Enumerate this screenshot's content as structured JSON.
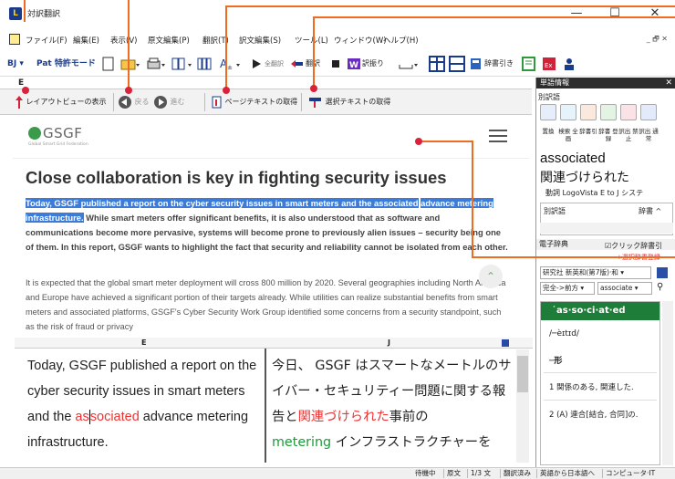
{
  "window": {
    "title": "対訳翻訳",
    "min": "—",
    "max": "☐",
    "close": "✕"
  },
  "menu": {
    "items": [
      "ファイル(F)",
      "編集(E)",
      "表示(V)",
      "原文編集(P)",
      "翻訳(T)",
      "訳文編集(S)",
      "ツール(L)",
      "ウィンドウ(W)",
      "ヘルプ(H)"
    ],
    "mdi": "_ 🗗 ✕"
  },
  "toolbar": {
    "bj": "BJ ▾",
    "pat": "Pat 特許モード",
    "all_translate": "全翻訳",
    "translate": "翻訳",
    "translate_cut": "訳振り",
    "dict_lookup": "辞書引き"
  },
  "pane_e": {
    "label": "E"
  },
  "nav": {
    "layout_view": "レイアウトビューの表示",
    "back": "戻る",
    "forward": "進む",
    "get_page_text": "ページテキストの取得",
    "get_selected_text": "選択テキストの取得"
  },
  "web": {
    "logo": "GSGF",
    "logo_tag": "Global Smart Grid Federation",
    "headline": "Close collaboration is key in fighting security issues",
    "para1_highlight_a": "Today, GSGF published a report on the cyber security issues in smart meters and the associated",
    "para1_highlight_b": "advance metering infrastructure.",
    "para1_rest": " While smart meters offer significant benefits, it is also understood that as software and communications become more pervasive, systems will become prone to previously alien issues – security being one of them. In this report, GSGF wants to highlight the fact that security and reliability cannot be isolated from each other.",
    "para2": "It is expected that the global smart meter deployment will cross 800 million by 2020. Several geographies including North America and Europe have achieved a significant portion of their targets already. While utilities can realize substantial benefits from smart meters and associated platforms, GSGF's Cyber Security Work Group identified some concerns from a security standpoint, such as the risk of fraud or privacy"
  },
  "parallel": {
    "col_e": "E",
    "col_j": "J",
    "src_a": "Today, GSGF published a report on the cyber security issues in smart meters and the ",
    "src_b": "as",
    "src_c": "sociated",
    "src_d": " advance metering infrastructure.",
    "tgt_a": "今日、 GSGF はスマートなメートルのサイバー・セキュリティー問題に関する報告と",
    "tgt_b": "関連づけられた",
    "tgt_c": "事前の",
    "tgt_d": "metering",
    "tgt_e": " インフラストラクチャーを"
  },
  "right_panel": {
    "title": "単語情報",
    "close": "✕",
    "betsu": "別訳語",
    "icons": [
      {
        "label": "置換",
        "color": "#1a4fa0"
      },
      {
        "label": "検索 全画",
        "color": "#4b9fd6"
      },
      {
        "label": "辞書引",
        "color": "#d55b1c"
      },
      {
        "label": "辞書 登録",
        "color": "#2e9a3a"
      },
      {
        "label": "訳出 禁止",
        "color": "#c6223a"
      },
      {
        "label": "訳出 通常",
        "color": "#2d63c0"
      }
    ],
    "word": "associated",
    "translation": "関連づけられた",
    "pos_line": "動詞 LogoVista E to J システ",
    "alt_label": "別訳語",
    "dict_label": "辞書 ^",
    "ed_header": "電子辞典",
    "click_dict": "☑クリック辞書引",
    "add_dict": "+選択辞書登録",
    "dict_select": "研究社 新英和(第7版)·和 ▾",
    "match_select": "完全->前方 ▾",
    "match_input": "associate ▾",
    "entry_head": "˙as·so·ci·at·ed",
    "entry_pron": "/─ѐɪtɪd/",
    "entry_pos": "─形",
    "entry_def1": "1 関係のある, 関連した.",
    "entry_def2": "2 (A) 連合[結合, 合同]の."
  },
  "status": {
    "items": [
      "待機中",
      "原文",
      "1/3 文",
      "翻訳済み",
      "英語から日本語へ",
      "コンピュータ·IT"
    ]
  }
}
